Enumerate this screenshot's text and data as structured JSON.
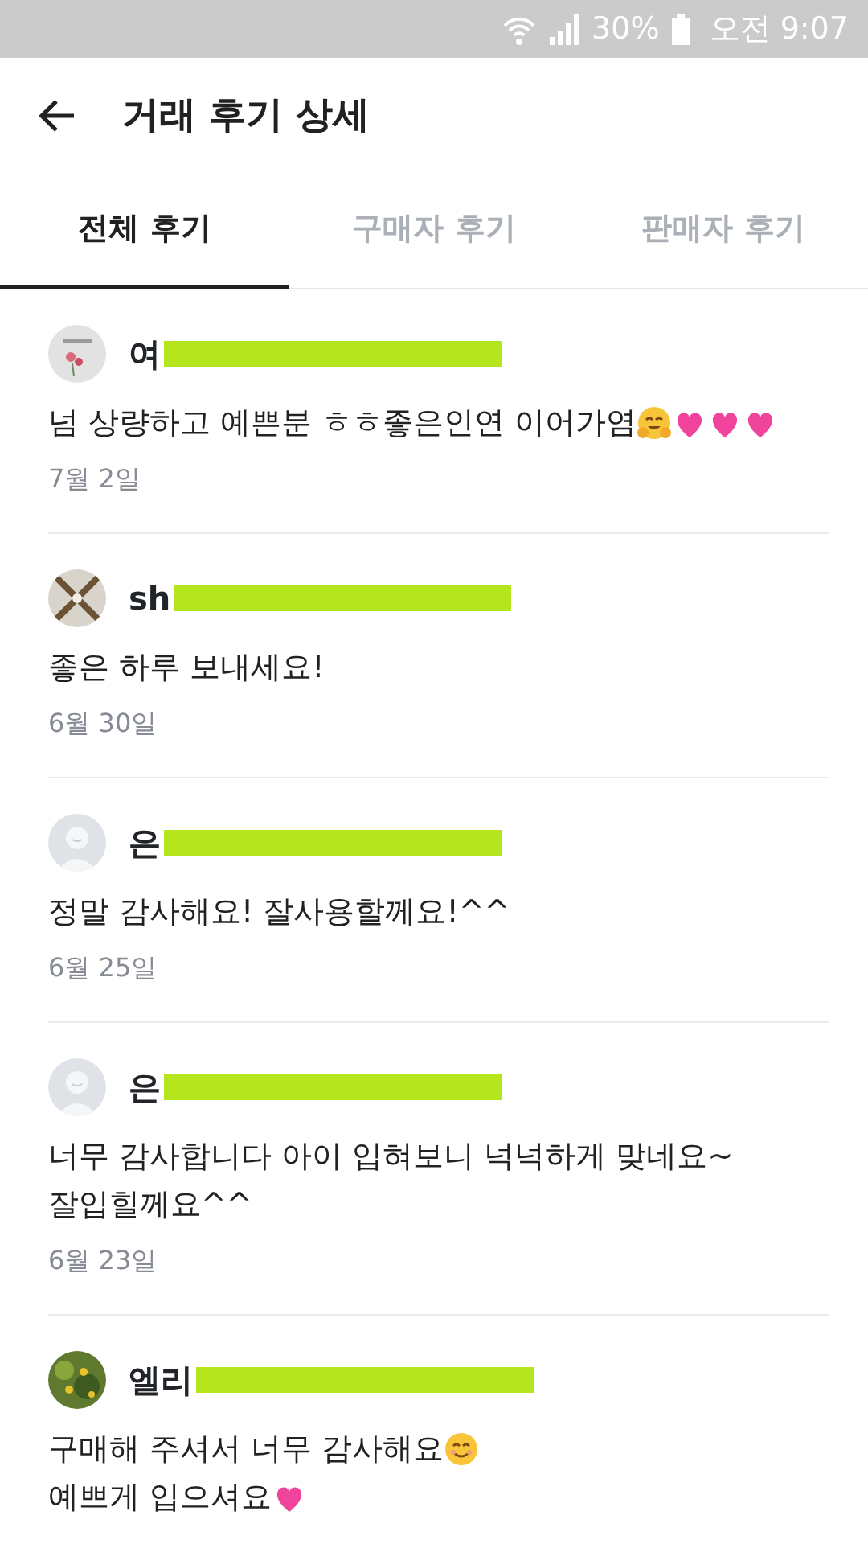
{
  "status_bar": {
    "battery": "30%",
    "time": "오전 9:07"
  },
  "header": {
    "title": "거래 후기 상세"
  },
  "tabs": [
    {
      "label": "전체 후기",
      "selected": true
    },
    {
      "label": "구매자 후기",
      "selected": false
    },
    {
      "label": "판매자 후기",
      "selected": false
    }
  ],
  "reviews": [
    {
      "avatar": {
        "kind": "picture"
      },
      "name": "여",
      "redacted": true,
      "lines": [
        {
          "text": "넘 상량하고 예쁜분 ㅎㅎ좋은인연 이어가염",
          "emojis": [
            {
              "kind": "hug"
            },
            {
              "kind": "heart"
            },
            {
              "kind": "heart"
            },
            {
              "kind": "heart"
            }
          ]
        }
      ],
      "date": "7월 2일"
    },
    {
      "avatar": {
        "kind": "picture"
      },
      "name": "sh",
      "redacted": true,
      "lines": [
        {
          "text": "좋은 하루 보내세요!"
        }
      ],
      "date": "6월 30일"
    },
    {
      "avatar": {
        "kind": "default"
      },
      "name": "은",
      "redacted": true,
      "lines": [
        {
          "text": "정말 감사해요! 잘사용할께요!^^"
        }
      ],
      "date": "6월 25일"
    },
    {
      "avatar": {
        "kind": "default"
      },
      "name": "은",
      "redacted": true,
      "lines": [
        {
          "text": "너무 감사합니다 아이 입혀보니 넉넉하게 맞네요~"
        },
        {
          "text": "잘입힐께요^^"
        }
      ],
      "date": "6월 23일"
    },
    {
      "avatar": {
        "kind": "picture"
      },
      "name": "엘리",
      "redacted": true,
      "lines": [
        {
          "text": "구매해 주셔서 너무 감사해요",
          "emojis": [
            {
              "kind": "smile"
            }
          ]
        },
        {
          "text": "예쁘게 입으셔요",
          "emojis": [
            {
              "kind": "heart"
            }
          ]
        }
      ]
    }
  ]
}
